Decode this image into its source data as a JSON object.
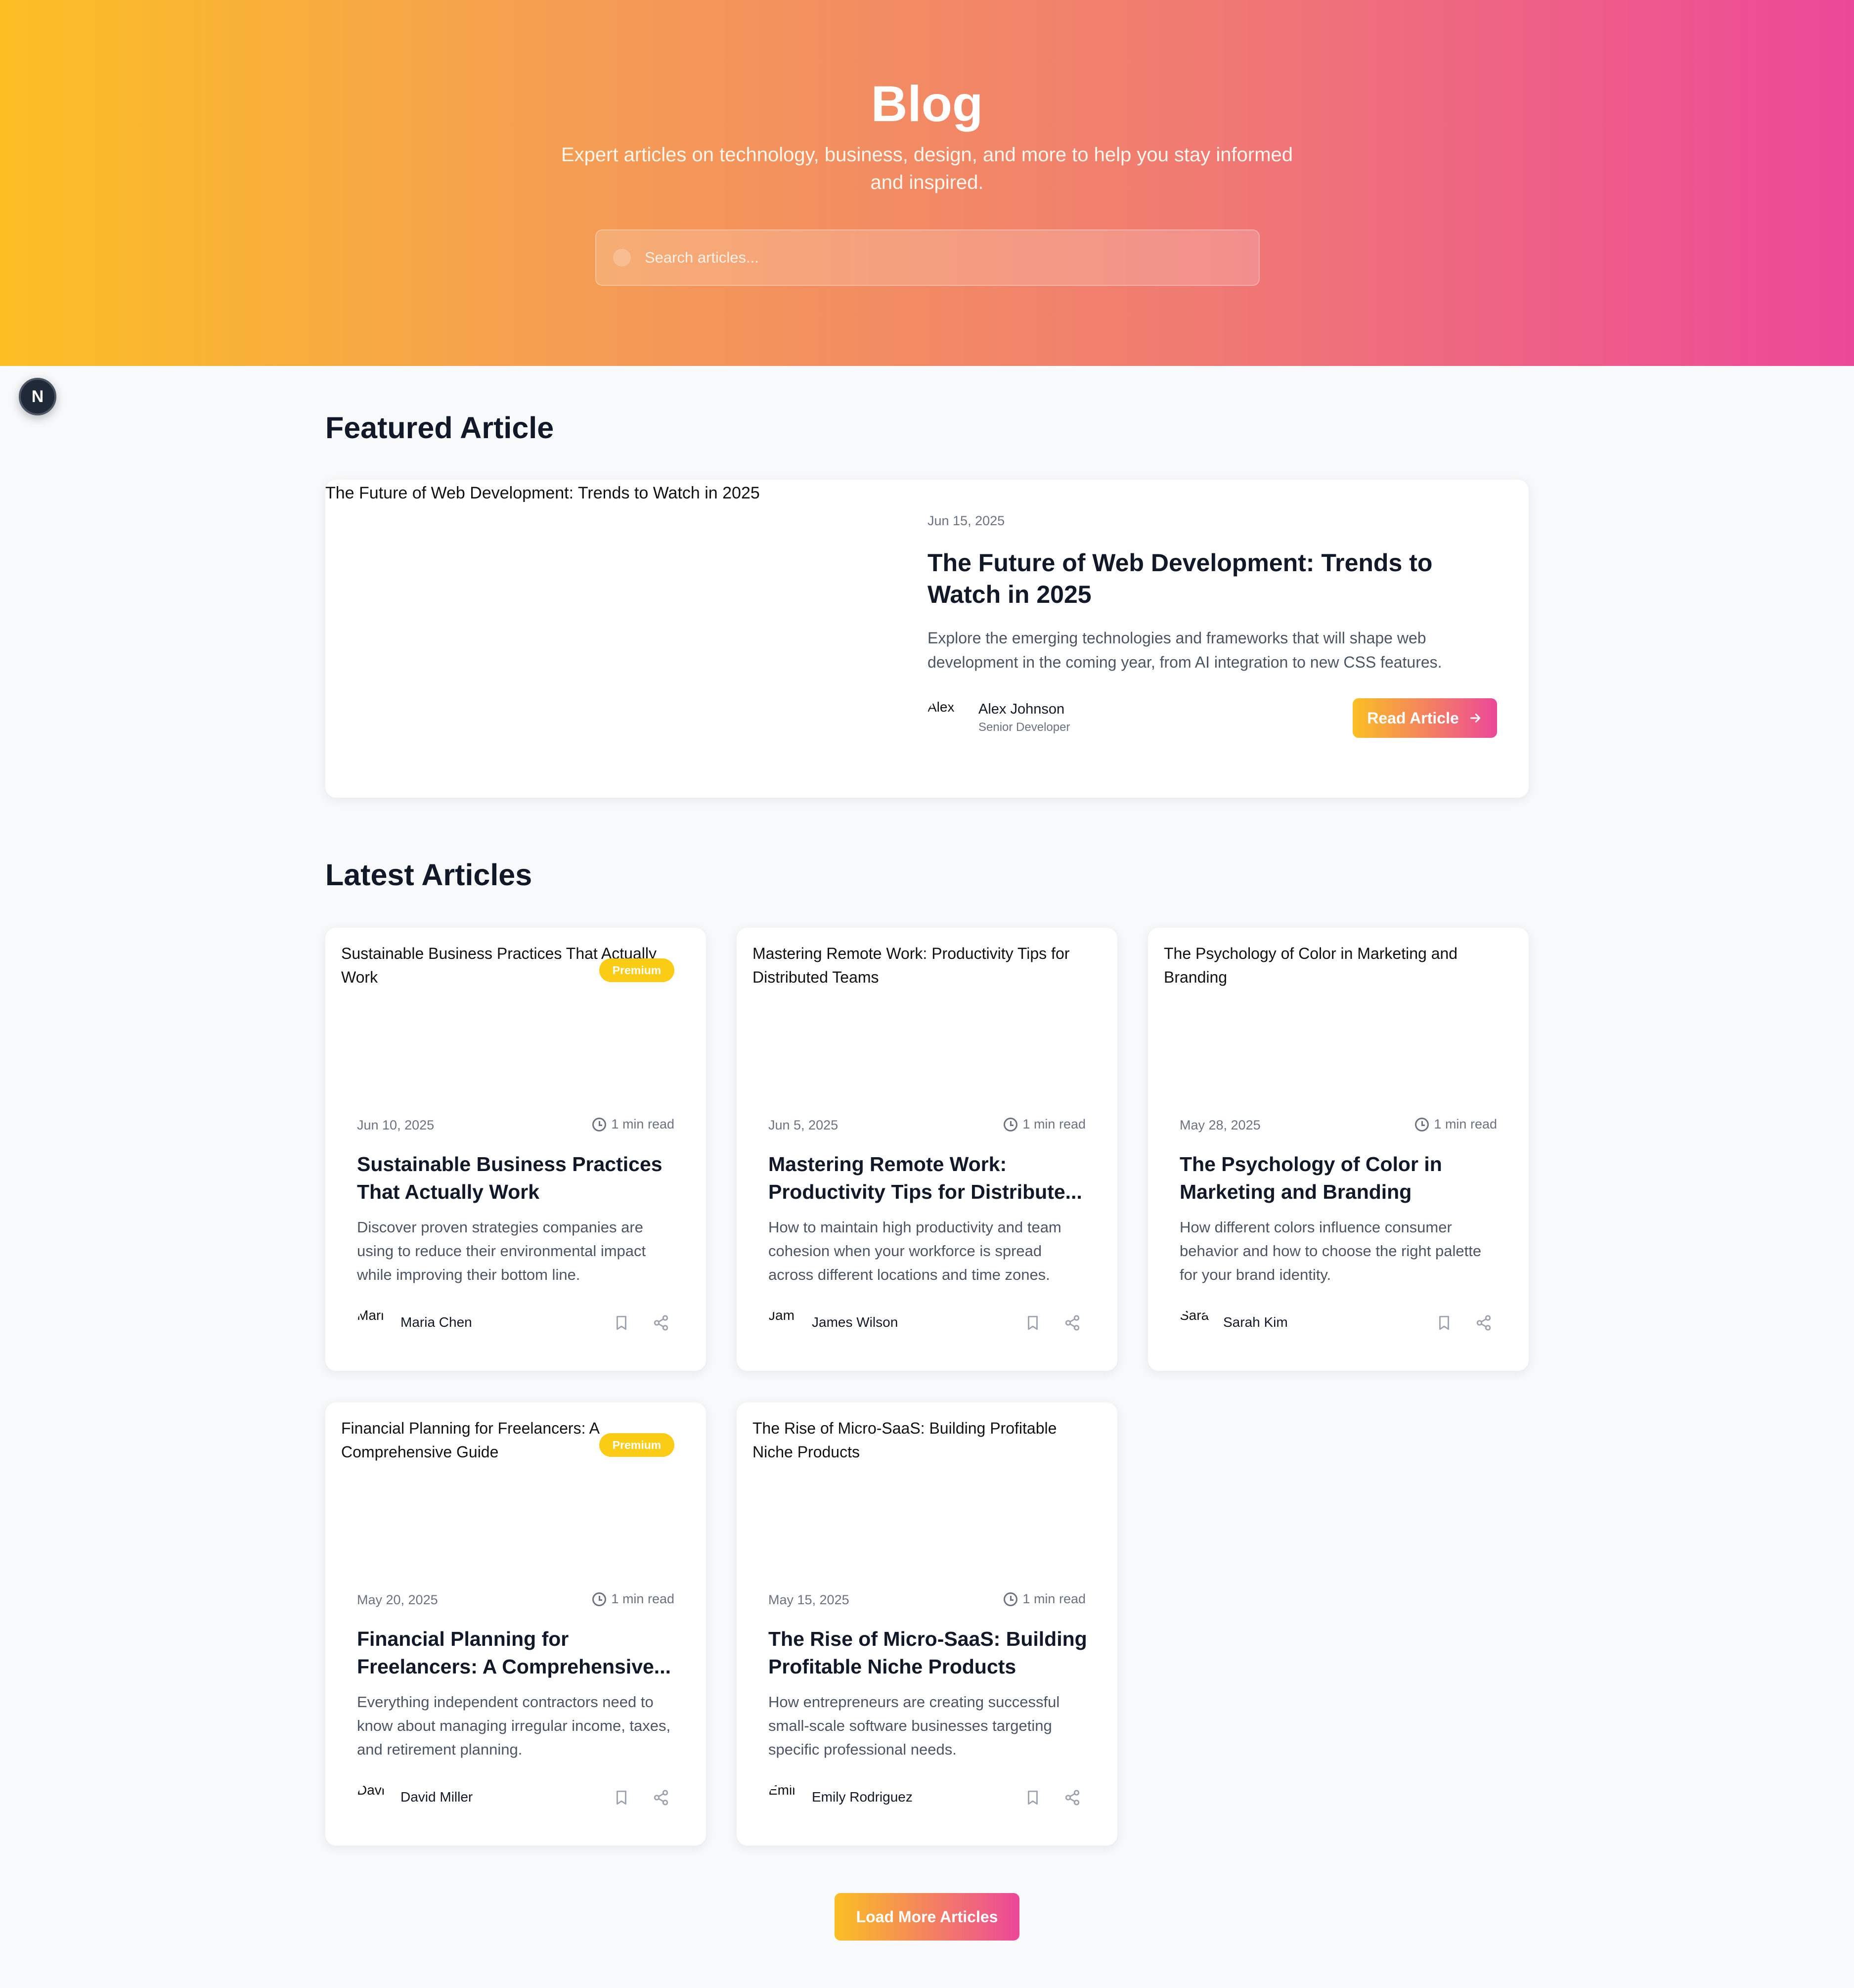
{
  "hero": {
    "title": "Blog",
    "subtitle": "Expert articles on technology, business, design, and more to help you stay informed and inspired.",
    "search_placeholder": "Search articles..."
  },
  "dev_badge": {
    "label": "N"
  },
  "featured": {
    "heading": "Featured Article",
    "image_alt": "The Future of Web Development: Trends to Watch in 2025",
    "date": "Jun 15, 2025",
    "title": "The Future of Web Development: Trends to Watch in 2025",
    "excerpt": "Explore the emerging technologies and frameworks that will shape web development in the coming year, from AI integration to new CSS features.",
    "author": {
      "avatar_alt": "Alex",
      "name": "Alex Johnson",
      "role": "Senior Developer"
    },
    "read_button": "Read Article",
    "read_icon": "arrow-right-icon"
  },
  "latest": {
    "heading": "Latest Articles",
    "cards": [
      {
        "image_alt": "Sustainable Business Practices That Actually Work",
        "badge": "Premium",
        "date": "Jun 10, 2025",
        "read_time": "1 min read",
        "title": "Sustainable Business Practices That Actually Work",
        "excerpt": "Discover proven strategies companies are using to reduce their environmental impact while improving their bottom line.",
        "avatar_alt": "Mari",
        "author": "Maria Chen"
      },
      {
        "image_alt": "Mastering Remote Work: Productivity Tips for Distributed Teams",
        "badge": "",
        "date": "Jun 5, 2025",
        "read_time": "1 min read",
        "title": "Mastering Remote Work: Productivity Tips for Distribute...",
        "excerpt": "How to maintain high productivity and team cohesion when your workforce is spread across different locations and time zones.",
        "avatar_alt": "Jam",
        "author": "James Wilson"
      },
      {
        "image_alt": "The Psychology of Color in Marketing and Branding",
        "badge": "",
        "date": "May 28, 2025",
        "read_time": "1 min read",
        "title": "The Psychology of Color in Marketing and Branding",
        "excerpt": "How different colors influence consumer behavior and how to choose the right palette for your brand identity.",
        "avatar_alt": "Sara",
        "author": "Sarah Kim"
      },
      {
        "image_alt": "Financial Planning for Freelancers: A Comprehensive Guide",
        "badge": "Premium",
        "date": "May 20, 2025",
        "read_time": "1 min read",
        "title": "Financial Planning for Freelancers: A Comprehensive...",
        "excerpt": "Everything independent contractors need to know about managing irregular income, taxes, and retirement planning.",
        "avatar_alt": "Davi",
        "author": "David Miller"
      },
      {
        "image_alt": "The Rise of Micro-SaaS: Building Profitable Niche Products",
        "badge": "",
        "date": "May 15, 2025",
        "read_time": "1 min read",
        "title": "The Rise of Micro-SaaS: Building Profitable Niche Products",
        "excerpt": "How entrepreneurs are creating successful small-scale software businesses targeting specific professional needs.",
        "avatar_alt": "Emil",
        "author": "Emily Rodriguez"
      }
    ]
  },
  "load_more": "Load More Articles",
  "colors": {
    "gradient_start": "#fbbf24",
    "gradient_end": "#ec4899",
    "premium_badge": "#facc15",
    "page_bg": "#f8f9fb"
  }
}
